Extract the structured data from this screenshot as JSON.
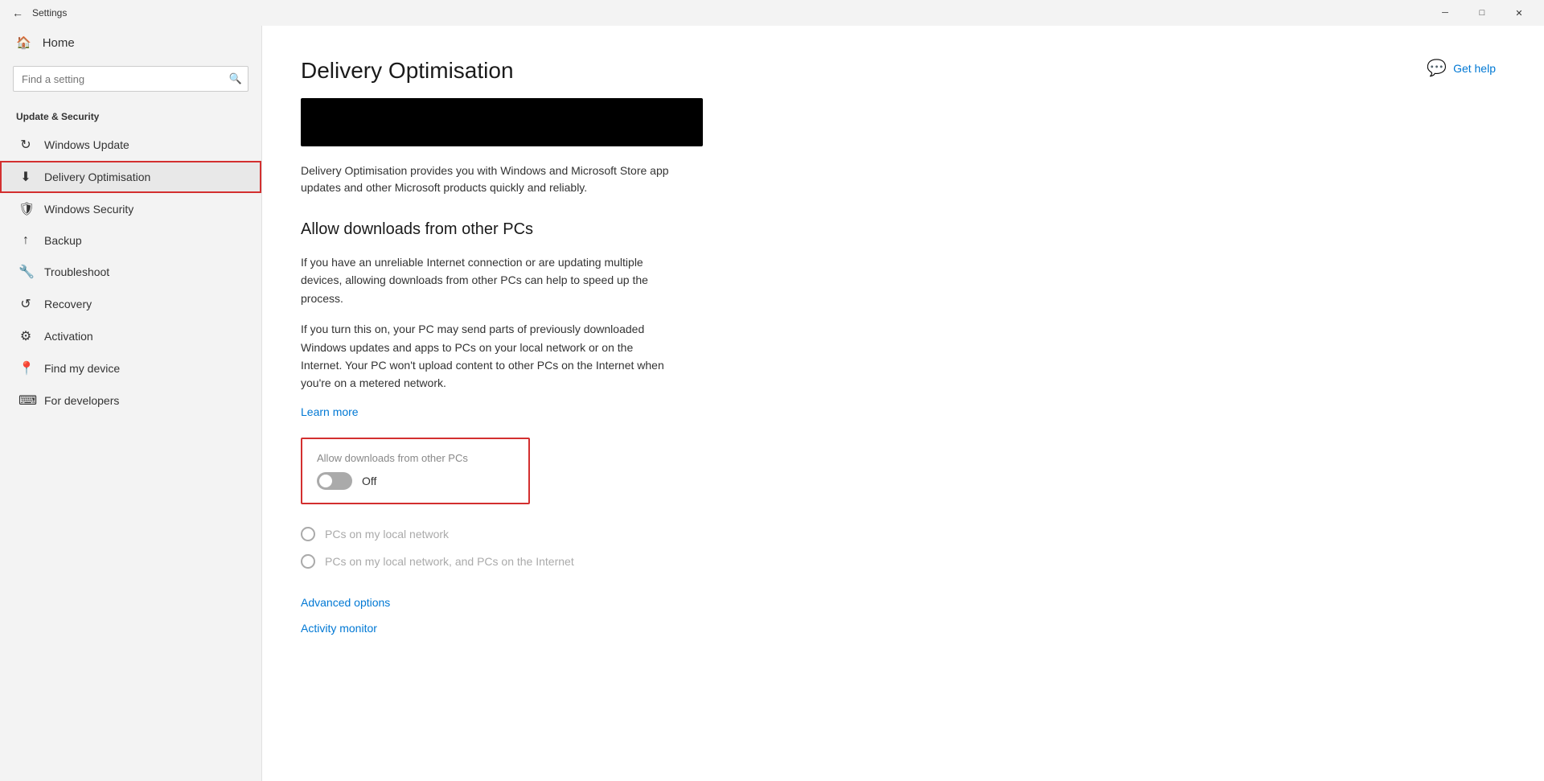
{
  "titlebar": {
    "title": "Settings",
    "back_label": "←",
    "minimize_label": "─",
    "maximize_label": "□",
    "close_label": "✕"
  },
  "sidebar": {
    "home_label": "Home",
    "search_placeholder": "Find a setting",
    "section_label": "Update & Security",
    "items": [
      {
        "id": "windows-update",
        "label": "Windows Update",
        "icon": "↻"
      },
      {
        "id": "delivery-optimisation",
        "label": "Delivery Optimisation",
        "icon": "⬇"
      },
      {
        "id": "windows-security",
        "label": "Windows Security",
        "icon": "🛡"
      },
      {
        "id": "backup",
        "label": "Backup",
        "icon": "↑"
      },
      {
        "id": "troubleshoot",
        "label": "Troubleshoot",
        "icon": "🔧"
      },
      {
        "id": "recovery",
        "label": "Recovery",
        "icon": "↺"
      },
      {
        "id": "activation",
        "label": "Activation",
        "icon": "⚙"
      },
      {
        "id": "find-my-device",
        "label": "Find my device",
        "icon": "📍"
      },
      {
        "id": "for-developers",
        "label": "For developers",
        "icon": "⌨"
      }
    ]
  },
  "main": {
    "page_title": "Delivery Optimisation",
    "page_description": "Delivery Optimisation provides you with Windows and Microsoft Store app updates and other Microsoft products quickly and reliably.",
    "section_title": "Allow downloads from other PCs",
    "desc_paragraph1": "If you have an unreliable Internet connection or are updating multiple devices, allowing downloads from other PCs can help to speed up the process.",
    "desc_paragraph2": "If you turn this on, your PC may send parts of previously downloaded Windows updates and apps to PCs on your local network or on the Internet. Your PC won't upload content to other PCs on the Internet when you're on a metered network.",
    "learn_more": "Learn more",
    "toggle_label": "Allow downloads from other PCs",
    "toggle_state": "Off",
    "radio_option1": "PCs on my local network",
    "radio_option2": "PCs on my local network, and PCs on the Internet",
    "advanced_options_link": "Advanced options",
    "activity_monitor_link": "Activity monitor",
    "get_help_label": "Get help"
  }
}
